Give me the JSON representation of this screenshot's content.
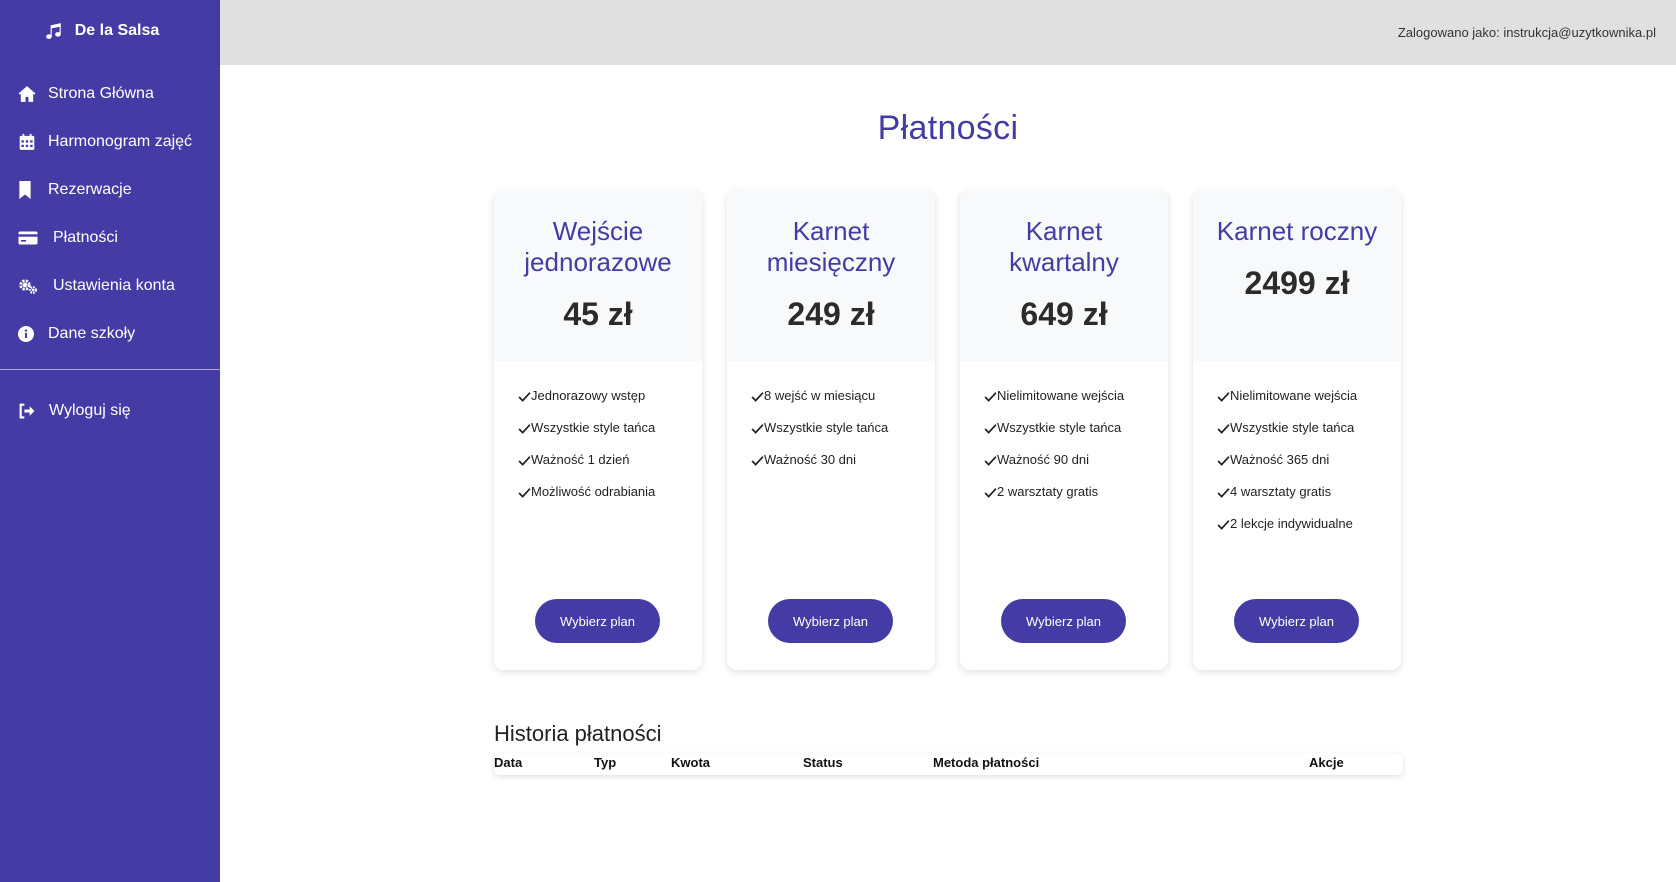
{
  "app": {
    "name": "De la Salsa",
    "logo_icon": "music-note-icon"
  },
  "sidebar": {
    "items": [
      {
        "label": "Strona Główna",
        "icon": "home-icon"
      },
      {
        "label": "Harmonogram zajęć",
        "icon": "calendar-icon"
      },
      {
        "label": "Rezerwacje",
        "icon": "bookmark-icon"
      },
      {
        "label": "Płatności",
        "icon": "credit-card-icon"
      },
      {
        "label": "Ustawienia konta",
        "icon": "gears-icon"
      },
      {
        "label": "Dane szkoły",
        "icon": "info-icon"
      }
    ],
    "logout": {
      "label": "Wyloguj się",
      "icon": "sign-out-icon"
    }
  },
  "header": {
    "user_text": "Zalogowano jako: instrukcja@uzytkownika.pl"
  },
  "page": {
    "title": "Płatności"
  },
  "plans": [
    {
      "name": "Wejście jednorazowe",
      "price": "45 zł",
      "features": [
        "Jednorazowy wstęp",
        "Wszystkie style tańca",
        "Ważność 1 dzień",
        "Możliwość odrabiania"
      ],
      "button": "Wybierz plan"
    },
    {
      "name": "Karnet miesięczny",
      "price": "249 zł",
      "features": [
        "8 wejść w miesiącu",
        "Wszystkie style tańca",
        "Ważność 30 dni"
      ],
      "button": "Wybierz plan"
    },
    {
      "name": "Karnet kwartalny",
      "price": "649 zł",
      "features": [
        "Nielimitowane wejścia",
        "Wszystkie style tańca",
        "Ważność 90 dni",
        "2 warsztaty gratis"
      ],
      "button": "Wybierz plan"
    },
    {
      "name": "Karnet roczny",
      "price": "2499 zł",
      "features": [
        "Nielimitowane wejścia",
        "Wszystkie style tańca",
        "Ważność 365 dni",
        "4 warsztaty gratis",
        "2 lekcje indywidualne"
      ],
      "button": "Wybierz plan"
    }
  ],
  "history": {
    "title": "Historia płatności",
    "columns": [
      "Data",
      "Typ",
      "Kwota",
      "Status",
      "Metoda płatności",
      "Akcje"
    ]
  },
  "colors": {
    "accent": "#443ca4",
    "header_bg": "#e0e0e0",
    "card_head_bg": "#f8f9fa"
  }
}
